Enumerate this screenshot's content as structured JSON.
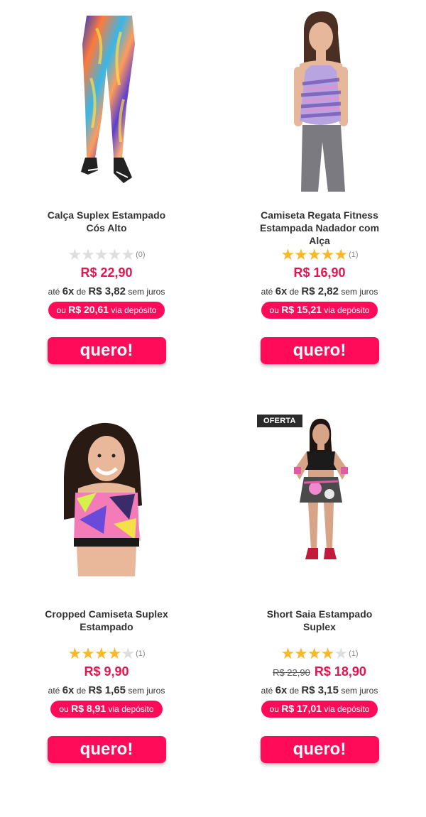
{
  "currency": "R$",
  "products": [
    {
      "name": "Calça Suplex Estampado Cós Alto",
      "rating": 0,
      "reviews": "(0)",
      "old_price": "",
      "price": "R$ 22,90",
      "install_prefix": "até",
      "install_count": "6x",
      "install_mid": "de",
      "install_value": "R$ 3,82",
      "install_suffix": "sem juros",
      "deposit_prefix": "ou",
      "deposit_value": "R$ 20,61",
      "deposit_suffix": "via depósito",
      "button": "quero!",
      "badge": ""
    },
    {
      "name": "Camiseta Regata Fitness Estampada Nadador com Alça",
      "rating": 5,
      "reviews": "(1)",
      "old_price": "",
      "price": "R$ 16,90",
      "install_prefix": "até",
      "install_count": "6x",
      "install_mid": "de",
      "install_value": "R$ 2,82",
      "install_suffix": "sem juros",
      "deposit_prefix": "ou",
      "deposit_value": "R$ 15,21",
      "deposit_suffix": "via depósito",
      "button": "quero!",
      "badge": ""
    },
    {
      "name": "Cropped Camiseta Suplex Estampado",
      "rating": 4,
      "reviews": "(1)",
      "old_price": "",
      "price": "R$ 9,90",
      "install_prefix": "até",
      "install_count": "6x",
      "install_mid": "de",
      "install_value": "R$ 1,65",
      "install_suffix": "sem juros",
      "deposit_prefix": "ou",
      "deposit_value": "R$ 8,91",
      "deposit_suffix": "via depósito",
      "button": "quero!",
      "badge": ""
    },
    {
      "name": "Short Saia Estampado Suplex",
      "rating": 4,
      "reviews": "(1)",
      "old_price": "R$ 22,90",
      "price": "R$ 18,90",
      "install_prefix": "até",
      "install_count": "6x",
      "install_mid": "de",
      "install_value": "R$ 3,15",
      "install_suffix": "sem juros",
      "deposit_prefix": "ou",
      "deposit_value": "R$ 17,01",
      "deposit_suffix": "via depósito",
      "button": "quero!",
      "badge": "OFERTA"
    }
  ],
  "colors": {
    "price": "#e8144f",
    "button": "#ff0b5a",
    "star_on": "#f7b92b",
    "star_off": "#dedede",
    "badge_bg": "#2b2b2b"
  },
  "icons": {
    "star": "star-icon"
  }
}
